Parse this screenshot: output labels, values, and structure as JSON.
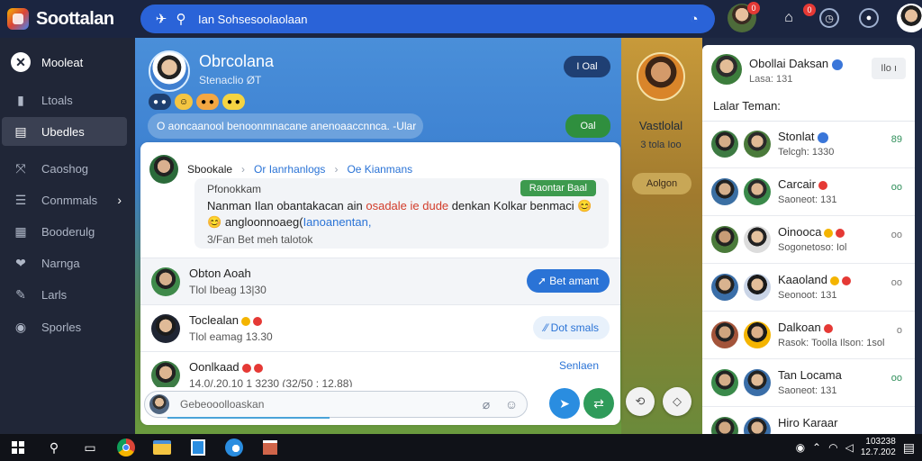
{
  "app": {
    "name": "Soottalan"
  },
  "search": {
    "query": "Ian Sohsesoolaolaan"
  },
  "topbar": {
    "notif_badge": "0",
    "alert_badge": "0"
  },
  "sidebar": {
    "items": [
      {
        "label": "Mooleat",
        "icon": "x-circle-icon"
      },
      {
        "label": "Ltoals",
        "icon": "bookmark-icon"
      },
      {
        "label": "Ubedles",
        "icon": "card-icon"
      },
      {
        "label": "Caoshog",
        "icon": "split-icon"
      },
      {
        "label": "Conmmals",
        "icon": "list-icon"
      },
      {
        "label": "Booderulg",
        "icon": "grid-icon"
      },
      {
        "label": "Narnga",
        "icon": "heart-icon"
      },
      {
        "label": "Larls",
        "icon": "pencil-icon"
      },
      {
        "label": "Sporles",
        "icon": "circle-icon"
      }
    ]
  },
  "profile": {
    "name": "Obrcolana",
    "subtitle": "Stenaclio  ØT",
    "status_line": "O aoncaanool benoonmnacane anenoaaccnnca.   -Ular",
    "pill_dark": "I Oal",
    "pill_green": "Oal"
  },
  "story": {
    "name": "Vastlolal",
    "meta": "3 tola  Ioo",
    "chip": "Aolgon"
  },
  "post": {
    "author": "Sbookale",
    "crumb1": "Or Ianrhanlogs",
    "crumb2": "Oe Kianmans",
    "who": "Pfonokkam",
    "text_a": "Nanman Ilan obantakacan ain ",
    "text_red": "osadale ie dude",
    "text_b": " denkan Kolkar benmaci",
    "text_c": "angloonnoaeg(",
    "text_link": "Ianoanentan,",
    "meta": "3/Fan  Bet  meh  talotok",
    "tag": "Raontar Baal"
  },
  "rows": [
    {
      "name": "Obton Aoah",
      "sub": "Tlol  Ibeag  13|30",
      "button": "Bet amant"
    },
    {
      "name": "Toclealan",
      "sub": "Tlol  eamag  13.30",
      "button": "Dot smals"
    },
    {
      "name": "Oonlkaad",
      "sub": "14.0/.20.10  1 3230  (32/50 : 12.88)",
      "button": "Senlaen"
    }
  ],
  "composer": {
    "placeholder": "Gebeooolloaskan"
  },
  "right": {
    "name": "Obollai Daksan",
    "subtitle": "Lasa: 131",
    "header_button": "Ilo ı",
    "section_title": "Lalar Teman:",
    "friends": [
      {
        "name": "Stonlat",
        "sub": "Telcgh: 1330",
        "action": "89",
        "dot": "blue"
      },
      {
        "name": "Carcair",
        "sub": "Saoneot: 131",
        "action": "oo",
        "dot": "red"
      },
      {
        "name": "Oinooca",
        "sub": "Sogonetoso: Iol",
        "action": "oo",
        "dot": "red"
      },
      {
        "name": "Kaaoland",
        "sub": "Seonoot: 131",
        "action": "oo",
        "dot": "red"
      },
      {
        "name": "Dalkoan",
        "sub": "Rasok:  Toolla Ilson: 1sol",
        "action": "o",
        "dot": "red"
      },
      {
        "name": "Tan Locama",
        "sub": "Saoneot: 131",
        "action": "oo",
        "dot": "none"
      },
      {
        "name": "Hiro Karaar",
        "sub": "",
        "action": "",
        "dot": "none"
      }
    ]
  },
  "taskbar": {
    "time": "103238",
    "date": "12.7.202"
  }
}
